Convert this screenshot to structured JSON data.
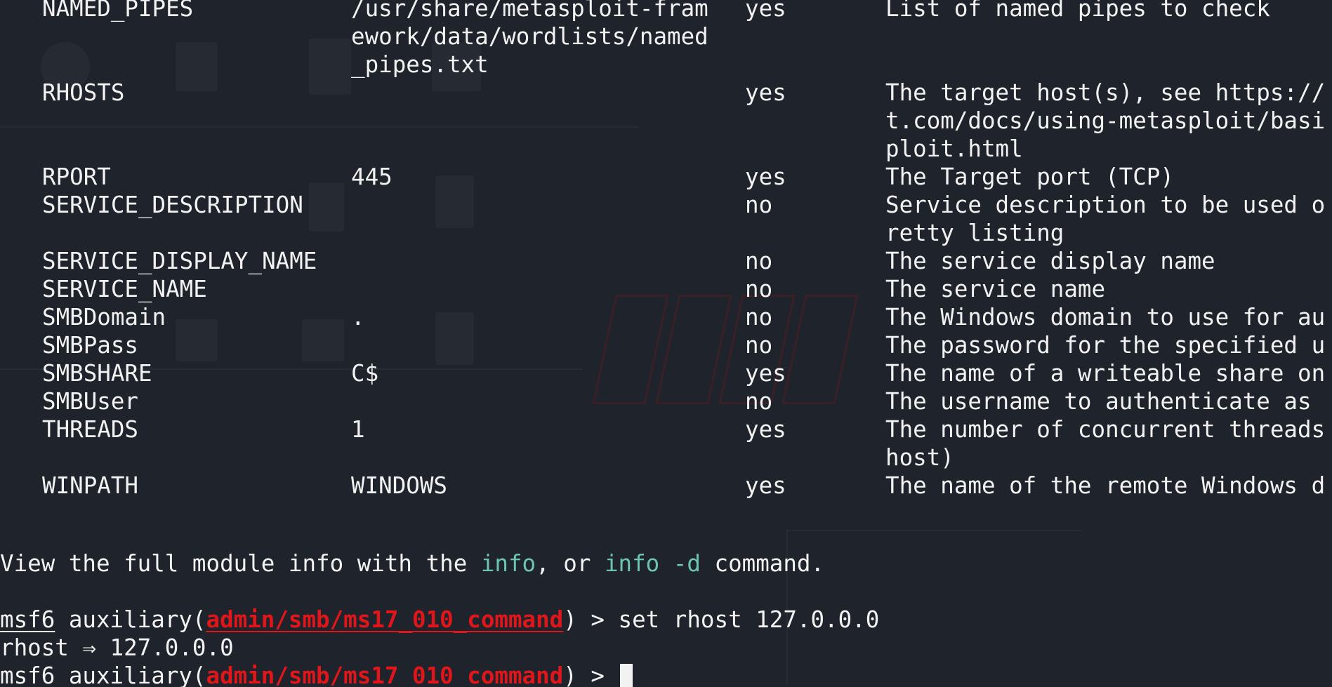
{
  "options": [
    {
      "name": "NAMED_PIPES",
      "value_lines": [
        "/usr/share/metasploit-fram",
        "ework/data/wordlists/named",
        "_pipes.txt"
      ],
      "required": "yes",
      "desc_lines": [
        "List of named pipes to check"
      ]
    },
    {
      "name": "RHOSTS",
      "value_lines": [
        ""
      ],
      "required": "yes",
      "desc_lines": [
        "The target host(s), see https://",
        "t.com/docs/using-metasploit/basi",
        "ploit.html"
      ]
    },
    {
      "name": "RPORT",
      "value_lines": [
        "445"
      ],
      "required": "yes",
      "desc_lines": [
        "The Target port (TCP)"
      ]
    },
    {
      "name": "SERVICE_DESCRIPTION",
      "value_lines": [
        ""
      ],
      "required": "no",
      "desc_lines": [
        "Service description to be used o",
        "retty listing"
      ]
    },
    {
      "name": "SERVICE_DISPLAY_NAME",
      "value_lines": [
        ""
      ],
      "required": "no",
      "desc_lines": [
        "The service display name"
      ]
    },
    {
      "name": "SERVICE_NAME",
      "value_lines": [
        ""
      ],
      "required": "no",
      "desc_lines": [
        "The service name"
      ]
    },
    {
      "name": "SMBDomain",
      "value_lines": [
        "."
      ],
      "required": "no",
      "desc_lines": [
        "The Windows domain to use for au"
      ]
    },
    {
      "name": "SMBPass",
      "value_lines": [
        ""
      ],
      "required": "no",
      "desc_lines": [
        "The password for the specified u"
      ]
    },
    {
      "name": "SMBSHARE",
      "value_lines": [
        "C$"
      ],
      "required": "yes",
      "desc_lines": [
        "The name of a writeable share on"
      ]
    },
    {
      "name": "SMBUser",
      "value_lines": [
        ""
      ],
      "required": "no",
      "desc_lines": [
        "The username to authenticate as"
      ]
    },
    {
      "name": "THREADS",
      "value_lines": [
        "1"
      ],
      "required": "yes",
      "desc_lines": [
        "The number of concurrent threads",
        "host)"
      ]
    },
    {
      "name": "WINPATH",
      "value_lines": [
        "WINDOWS"
      ],
      "required": "yes",
      "desc_lines": [
        "The name of the remote Windows d"
      ]
    }
  ],
  "info_line": {
    "prefix": "View the full module info with the ",
    "cmd1": "info",
    "middle": ", or ",
    "cmd2": "info -d",
    "suffix": " command."
  },
  "prompt": {
    "msf": "msf6",
    "type_open": " auxiliary(",
    "module": "admin/smb/ms17_010_command",
    "close": ") > "
  },
  "history": [
    {
      "command": "set rhost 127.0.0.0",
      "output": "rhost ⇒ 127.0.0.0"
    }
  ],
  "current_input": "",
  "colors": {
    "background": "#1f232b",
    "text": "#f2f2f2",
    "cyan": "#6cc5b0",
    "module_red": "#e0161b"
  }
}
